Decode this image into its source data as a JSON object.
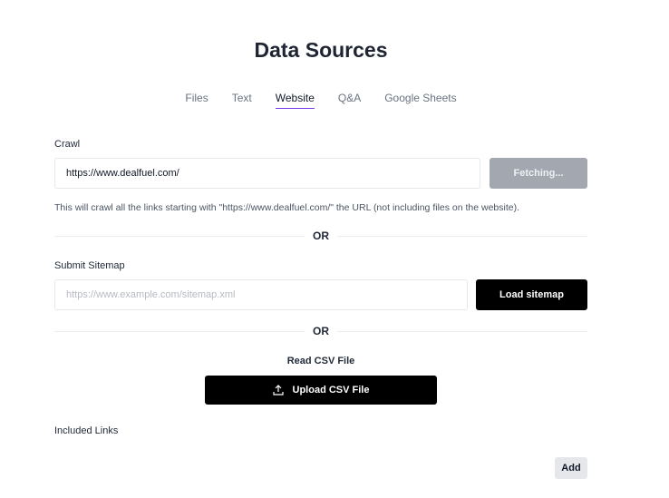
{
  "page": {
    "title": "Data Sources"
  },
  "tabs": [
    {
      "label": "Files",
      "active": false
    },
    {
      "label": "Text",
      "active": false
    },
    {
      "label": "Website",
      "active": true
    },
    {
      "label": "Q&A",
      "active": false
    },
    {
      "label": "Google Sheets",
      "active": false
    }
  ],
  "crawl": {
    "label": "Crawl",
    "url_value": "https://www.dealfuel.com/",
    "button_label": "Fetching...",
    "hint": "This will crawl all the links starting with \"https://www.dealfuel.com/\" the URL (not including files on the website)."
  },
  "divider": {
    "or_label": "OR"
  },
  "sitemap": {
    "label": "Submit Sitemap",
    "placeholder": "https://www.example.com/sitemap.xml",
    "button_label": "Load sitemap"
  },
  "csv": {
    "label": "Read CSV File",
    "button_label": "Upload CSV File",
    "icon": "upload-icon"
  },
  "included_links": {
    "label": "Included Links",
    "add_label": "Add"
  },
  "colors": {
    "accent_underline": "#7c3aed",
    "disabled_button": "#a3a7b0",
    "primary_button": "#000000"
  }
}
